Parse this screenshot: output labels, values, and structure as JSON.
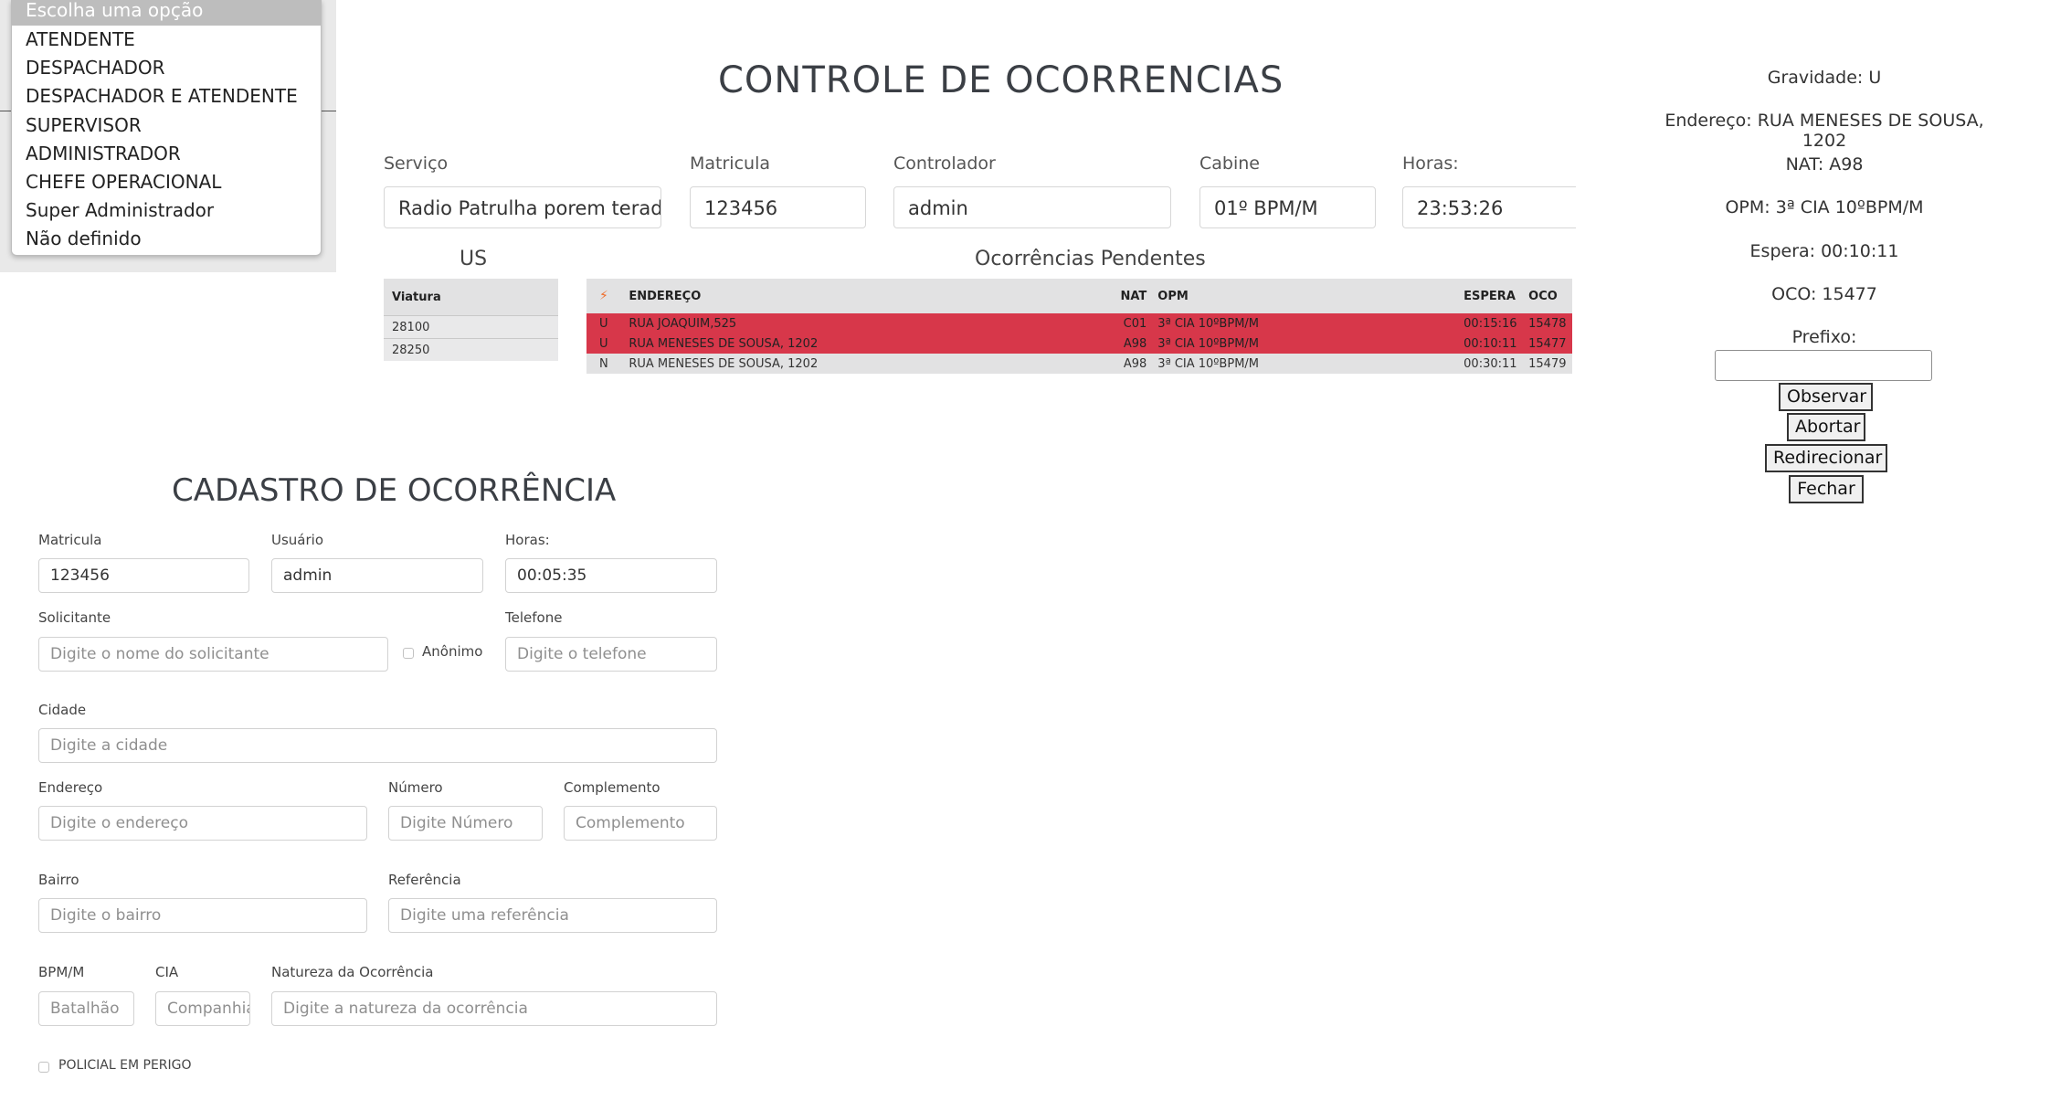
{
  "dropdown": {
    "selected": "Escolha uma opção",
    "options": [
      "ATENDENTE",
      "DESPACHADOR",
      "DESPACHADOR E ATENDENTE",
      "SUPERVISOR",
      "ADMINISTRADOR",
      "CHEFE OPERACIONAL",
      "Super Administrador",
      "Não definido"
    ]
  },
  "header": {
    "title": "CONTROLE DE OCORRENCIAS",
    "servico_label": "Serviço",
    "servico_value": "Radio Patrulha porem terad",
    "matricula_label": "Matricula",
    "matricula_value": "123456",
    "controlador_label": "Controlador",
    "controlador_value": "admin",
    "cabine_label": "Cabine",
    "cabine_value": "01º BPM/M",
    "horas_label": "Horas:",
    "horas_value": "23:53:26"
  },
  "us_table": {
    "title": "US",
    "header": "Viatura",
    "rows": [
      "28100",
      "28250"
    ]
  },
  "pending": {
    "title": "Ocorrências Pendentes",
    "headers": {
      "icon": "⚡",
      "endereco": "ENDEREÇO",
      "nat": "NAT",
      "opm": "OPM",
      "espera": "ESPERA",
      "oco": "OCO"
    },
    "rows": [
      {
        "g": "U",
        "endereco": "RUA JOAQUIM,525",
        "nat": "C01",
        "opm": "3ª CIA 10ºBPM/M",
        "espera": "00:15:16",
        "oco": "15478"
      },
      {
        "g": "U",
        "endereco": "RUA MENESES DE SOUSA, 1202",
        "nat": "A98",
        "opm": "3ª CIA 10ºBPM/M",
        "espera": "00:10:11",
        "oco": "15477"
      },
      {
        "g": "N",
        "endereco": "RUA MENESES DE SOUSA, 1202",
        "nat": "A98",
        "opm": "3ª CIA 10ºBPM/M",
        "espera": "00:30:11",
        "oco": "15479"
      }
    ],
    "colors": {
      "urgent": "#d7374a",
      "normal": "#e2e2e3",
      "icon": "#ef6c2a"
    }
  },
  "detail": {
    "gravidade": "Gravidade: U",
    "endereco": "Endereço: RUA MENESES DE SOUSA, 1202",
    "nat": "NAT: A98",
    "opm": "OPM: 3ª CIA 10ºBPM/M",
    "espera": "Espera: 00:10:11",
    "oco": "OCO: 15477",
    "prefixo_label": "Prefixo:",
    "prefixo_value": "",
    "buttons": {
      "observar": "Observar",
      "abortar": "Abortar",
      "redirecionar": "Redirecionar",
      "fechar": "Fechar"
    }
  },
  "form": {
    "title": "CADASTRO DE OCORRÊNCIA",
    "matricula_label": "Matricula",
    "matricula_value": "123456",
    "usuario_label": "Usuário",
    "usuario_value": "admin",
    "horas_label": "Horas:",
    "horas_value": "00:05:35",
    "solicitante_label": "Solicitante",
    "solicitante_placeholder": "Digite o nome do solicitante",
    "anonimo_label": "Anônimo",
    "telefone_label": "Telefone",
    "telefone_placeholder": "Digite o telefone",
    "cidade_label": "Cidade",
    "cidade_placeholder": "Digite a cidade",
    "endereco_label": "Endereço",
    "endereco_placeholder": "Digite o endereço",
    "numero_label": "Número",
    "numero_placeholder": "Digite Número",
    "complemento_label": "Complemento",
    "complemento_placeholder": "Complemento",
    "bairro_label": "Bairro",
    "bairro_placeholder": "Digite o bairro",
    "referencia_label": "Referência",
    "referencia_placeholder": "Digite uma referência",
    "bpm_label": "BPM/M",
    "bpm_placeholder": "Batalhão",
    "cia_label": "CIA",
    "cia_placeholder": "Companhia",
    "natureza_label": "Natureza da Ocorrência",
    "natureza_placeholder": "Digite a natureza da ocorrência",
    "policial_label": "POLICIAL EM PERIGO"
  }
}
